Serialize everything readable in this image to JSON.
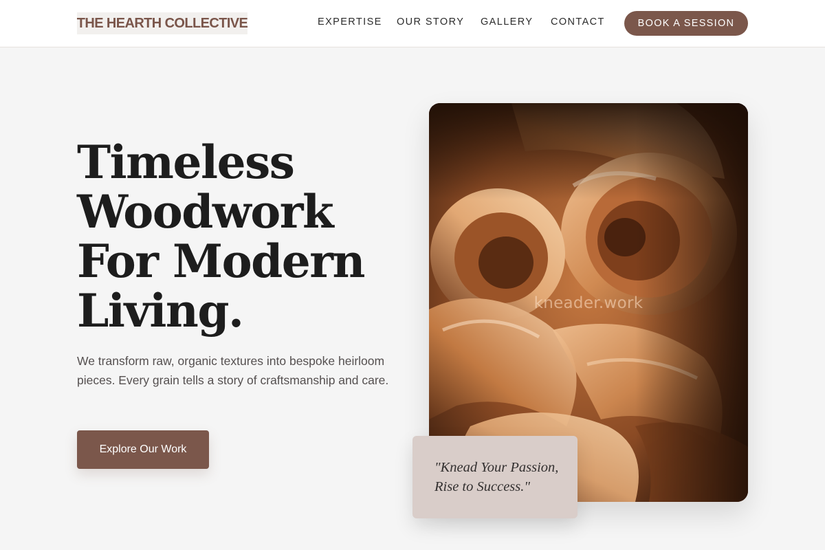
{
  "header": {
    "logo_text": "THE HEARTH COLLECTIVE",
    "nav": [
      {
        "label": "EXPERTISE"
      },
      {
        "label": "OUR STORY"
      },
      {
        "label": "GALLERY"
      },
      {
        "label": "CONTACT"
      }
    ],
    "cta_label": "BOOK A SESSION"
  },
  "hero": {
    "title_lines": [
      "Timeless",
      "Woodwork",
      "For Modern",
      "Living."
    ],
    "description": "We transform raw, organic textures into bespoke heirloom pieces. Every grain tells a story of craftsmanship and care.",
    "button_label": "Explore Our Work"
  },
  "image": {
    "subject": "wood shavings close-up",
    "watermark": "kneader.work"
  },
  "quote": {
    "lines": [
      "\"Knead Your Passion,",
      "Rise to Success.\""
    ]
  },
  "colors": {
    "accent": "#7b574b",
    "background": "#f5f5f5",
    "quote_card": "#d9cdc9"
  }
}
